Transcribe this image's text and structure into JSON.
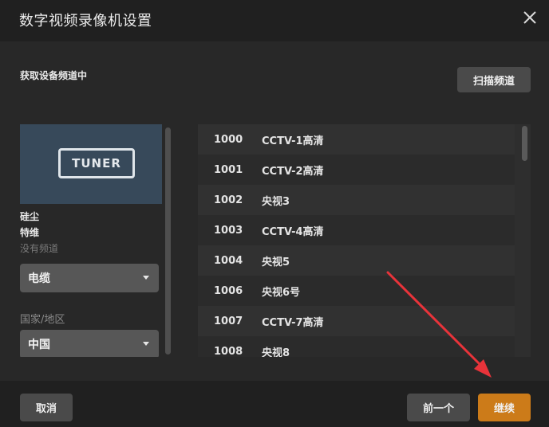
{
  "dialog": {
    "title": "数字视频录像机设置",
    "close_icon": "close-icon"
  },
  "status": {
    "text": "获取设备频道中"
  },
  "toolbar": {
    "scan_label": "扫描频道"
  },
  "device": {
    "tuner_label": "TUNER",
    "name": "硅尘",
    "model": "特维",
    "no_channels": "没有频道",
    "source_select": "电缆",
    "region_label": "国家/地区",
    "region_select": "中国"
  },
  "channels": [
    {
      "number": "1000",
      "name": "CCTV-1高清"
    },
    {
      "number": "1001",
      "name": "CCTV-2高清"
    },
    {
      "number": "1002",
      "name": "央视3"
    },
    {
      "number": "1003",
      "name": "CCTV-4高清"
    },
    {
      "number": "1004",
      "name": "央视5"
    },
    {
      "number": "1006",
      "name": "央视6号"
    },
    {
      "number": "1007",
      "name": "CCTV-7高清"
    },
    {
      "number": "1008",
      "name": "央视8"
    }
  ],
  "footer": {
    "cancel_label": "取消",
    "prev_label": "前一个",
    "next_label": "继续"
  },
  "colors": {
    "accent": "#cc7b19",
    "annotation_arrow": "#e8333a"
  }
}
